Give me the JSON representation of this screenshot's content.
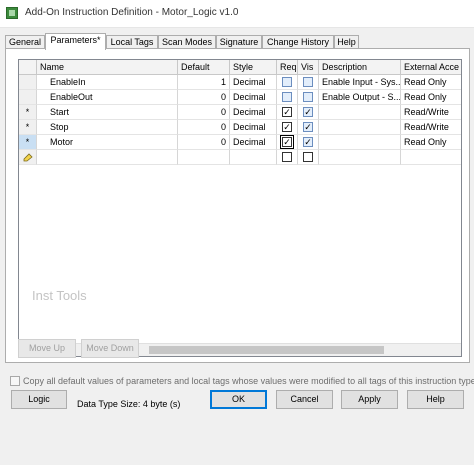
{
  "window": {
    "title": "Add-On Instruction Definition - Motor_Logic v1.0"
  },
  "tabs": [
    {
      "label": "General"
    },
    {
      "label": "Parameters*"
    },
    {
      "label": "Local Tags"
    },
    {
      "label": "Scan Modes"
    },
    {
      "label": "Signature"
    },
    {
      "label": "Change History"
    },
    {
      "label": "Help"
    }
  ],
  "grid": {
    "columns": [
      "Name",
      "Default",
      "Style",
      "Req",
      "Vis",
      "Description",
      "External Acce"
    ],
    "rows": [
      {
        "marker": "",
        "name": "EnableIn",
        "default": "1",
        "style": "Decimal",
        "req": false,
        "vis": false,
        "description": "Enable Input - Sys...",
        "access": "Read Only"
      },
      {
        "marker": "",
        "name": "EnableOut",
        "default": "0",
        "style": "Decimal",
        "req": false,
        "vis": false,
        "description": "Enable Output - S...",
        "access": "Read Only"
      },
      {
        "marker": "*",
        "name": "Start",
        "default": "0",
        "style": "Decimal",
        "req": true,
        "vis": true,
        "description": "",
        "access": "Read/Write"
      },
      {
        "marker": "*",
        "name": "Stop",
        "default": "0",
        "style": "Decimal",
        "req": true,
        "vis": true,
        "description": "",
        "access": "Read/Write"
      },
      {
        "marker": "*",
        "name": "Motor",
        "default": "0",
        "style": "Decimal",
        "req": true,
        "vis": true,
        "description": "",
        "access": "Read Only"
      }
    ],
    "new_row_icon": "new-row-pencil-icon"
  },
  "watermark": "Inst Tools",
  "buttons": {
    "move_up": "Move Up",
    "move_down": "Move Down",
    "logic": "Logic",
    "ok": "OK",
    "cancel": "Cancel",
    "apply": "Apply",
    "help": "Help"
  },
  "copy_defaults_label": "Copy all default values of parameters and local tags whose values were modified to all tags of this instruction type",
  "data_type_size": "Data Type Size: 4 byte (s)",
  "colors": {
    "focus_border": "#0078d7",
    "selected_row_header": "#c9dff3",
    "checkbox_blue": "#6c8ebf"
  }
}
